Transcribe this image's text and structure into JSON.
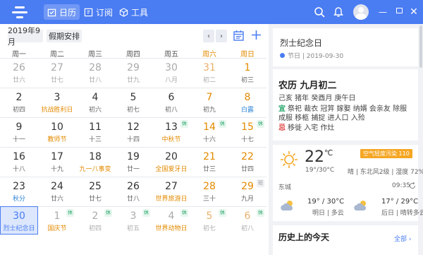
{
  "nav": {
    "calendar": "日历",
    "subscribe": "订阅",
    "tools": "工具"
  },
  "controls": {
    "month": "2019年9月",
    "holiday": "假期安排",
    "prev": "‹",
    "next": "›"
  },
  "weekdays": [
    "周一",
    "周二",
    "周三",
    "周四",
    "周五",
    "周六",
    "周日"
  ],
  "days": [
    {
      "n": "26",
      "l": "廿六",
      "o": true
    },
    {
      "n": "27",
      "l": "廿七",
      "o": true
    },
    {
      "n": "28",
      "l": "廿八",
      "o": true
    },
    {
      "n": "29",
      "l": "廿九",
      "o": true
    },
    {
      "n": "30",
      "l": "八月",
      "o": true
    },
    {
      "n": "31",
      "l": "初二",
      "o": true
    },
    {
      "n": "1",
      "l": "初三"
    },
    {
      "n": "2",
      "l": "初四"
    },
    {
      "n": "3",
      "l": "抗战胜利日",
      "f": true
    },
    {
      "n": "4",
      "l": "初六"
    },
    {
      "n": "5",
      "l": "初七"
    },
    {
      "n": "6",
      "l": "初八"
    },
    {
      "n": "7",
      "l": "初九"
    },
    {
      "n": "8",
      "l": "白露",
      "t": true
    },
    {
      "n": "9",
      "l": "十一"
    },
    {
      "n": "10",
      "l": "教师节",
      "f": true
    },
    {
      "n": "11",
      "l": "十三"
    },
    {
      "n": "12",
      "l": "十四"
    },
    {
      "n": "13",
      "l": "中秋节",
      "f": true,
      "b": "休"
    },
    {
      "n": "14",
      "l": "十六",
      "b": "休"
    },
    {
      "n": "15",
      "l": "十七",
      "b": "休"
    },
    {
      "n": "16",
      "l": "十八"
    },
    {
      "n": "17",
      "l": "十九"
    },
    {
      "n": "18",
      "l": "九一八事变",
      "f": true
    },
    {
      "n": "19",
      "l": "廿一"
    },
    {
      "n": "20",
      "l": "全国爱牙日",
      "f": true
    },
    {
      "n": "21",
      "l": "廿三"
    },
    {
      "n": "22",
      "l": "廿四"
    },
    {
      "n": "23",
      "l": "秋分",
      "t": true
    },
    {
      "n": "24",
      "l": "廿六"
    },
    {
      "n": "25",
      "l": "廿七"
    },
    {
      "n": "26",
      "l": "廿八"
    },
    {
      "n": "27",
      "l": "世界旅游日",
      "f": true
    },
    {
      "n": "28",
      "l": "三十"
    },
    {
      "n": "29",
      "l": "九月",
      "b": "班"
    },
    {
      "n": "30",
      "l": "烈士纪念日",
      "sel": true
    },
    {
      "n": "1",
      "l": "国庆节",
      "o": true,
      "f": true,
      "b": "休"
    },
    {
      "n": "2",
      "l": "初四",
      "o": true,
      "b": "休"
    },
    {
      "n": "3",
      "l": "初五",
      "o": true,
      "b": "休"
    },
    {
      "n": "4",
      "l": "世界动物日",
      "o": true,
      "f": true,
      "b": "休"
    },
    {
      "n": "5",
      "l": "初七",
      "o": true,
      "b": "休"
    },
    {
      "n": "6",
      "l": "初八",
      "o": true,
      "b": "休"
    }
  ],
  "event": {
    "title": "烈士纪念日",
    "meta": "节日 | 2019-09-30"
  },
  "lunar": {
    "date": "农历 九月初二",
    "ganzhi": "己亥 猪年 癸酉月 庚午日",
    "yi_label": "宜",
    "yi": "祭祀 裁衣 冠笄 嫁娶 纳婿 会亲友 除服 成服 移柩 捕捉 进人口 入殓",
    "ji_label": "忌",
    "ji": "移徙 入宅 作灶"
  },
  "weather": {
    "temp": "22",
    "unit": "℃",
    "range": "19°/30°C",
    "wind": "晴 | 东北风2级 | 湿度 72%",
    "aqi": "空气轻度污染 110",
    "city": "东城",
    "time": "09:35",
    "tomorrow": {
      "range": "19° / 30°C",
      "label": "明日 | 多云"
    },
    "after": {
      "range": "17° / 29°C",
      "label": "后日 | 晴转多云"
    }
  },
  "history": {
    "title": "历史上的今天",
    "more": "全部 ›"
  },
  "colors": {
    "accent": "#4a7cf2",
    "weekend": "#e38a00",
    "holiday": "#27a66b"
  }
}
